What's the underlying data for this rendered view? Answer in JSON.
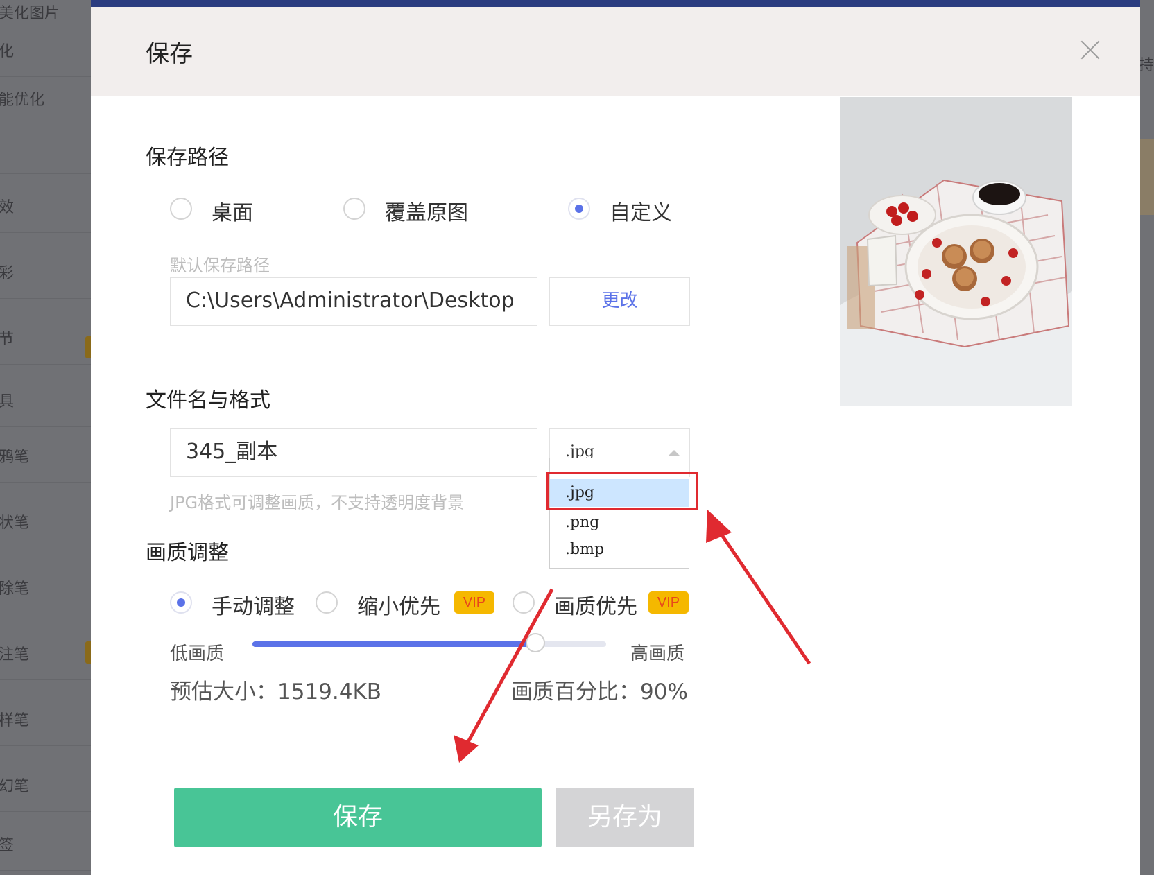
{
  "background": {
    "sidebar_items": [
      "美化图片",
      "化",
      "能优化",
      "",
      "效",
      "彩",
      "节",
      "具",
      "鸦笔",
      "状笔",
      "除笔",
      "注笔",
      "样笔",
      "幻笔",
      "签"
    ],
    "right_fragment": "持"
  },
  "dialog": {
    "title": "保存",
    "save_path": {
      "section_title": "保存路径",
      "options": [
        "桌面",
        "覆盖原图",
        "自定义"
      ],
      "selected": "自定义",
      "default_label": "默认保存路径",
      "path_value": "C:\\Users\\Administrator\\Desktop",
      "change_button": "更改"
    },
    "filename": {
      "section_title": "文件名与格式",
      "value": "345_副本",
      "format_selected": ".jpg",
      "format_options": [
        ".jpg",
        ".png",
        ".bmp"
      ],
      "hint": "JPG格式可调整画质，不支持透明度背景"
    },
    "quality": {
      "section_title": "画质调整",
      "modes": [
        "手动调整",
        "缩小优先",
        "画质优先"
      ],
      "selected_mode": "手动调整",
      "vip_badge": "VIP",
      "low_label": "低画质",
      "high_label": "高画质",
      "slider_value": 0.8,
      "estimated_size": "预估大小：1519.4KB",
      "percentage": "画质百分比：90%"
    },
    "buttons": {
      "save": "保存",
      "save_as": "另存为"
    }
  },
  "colors": {
    "accent": "#5b72e8",
    "save_green": "#48c596",
    "vip_yellow": "#f5b800",
    "annotation_red": "#e02a30"
  }
}
